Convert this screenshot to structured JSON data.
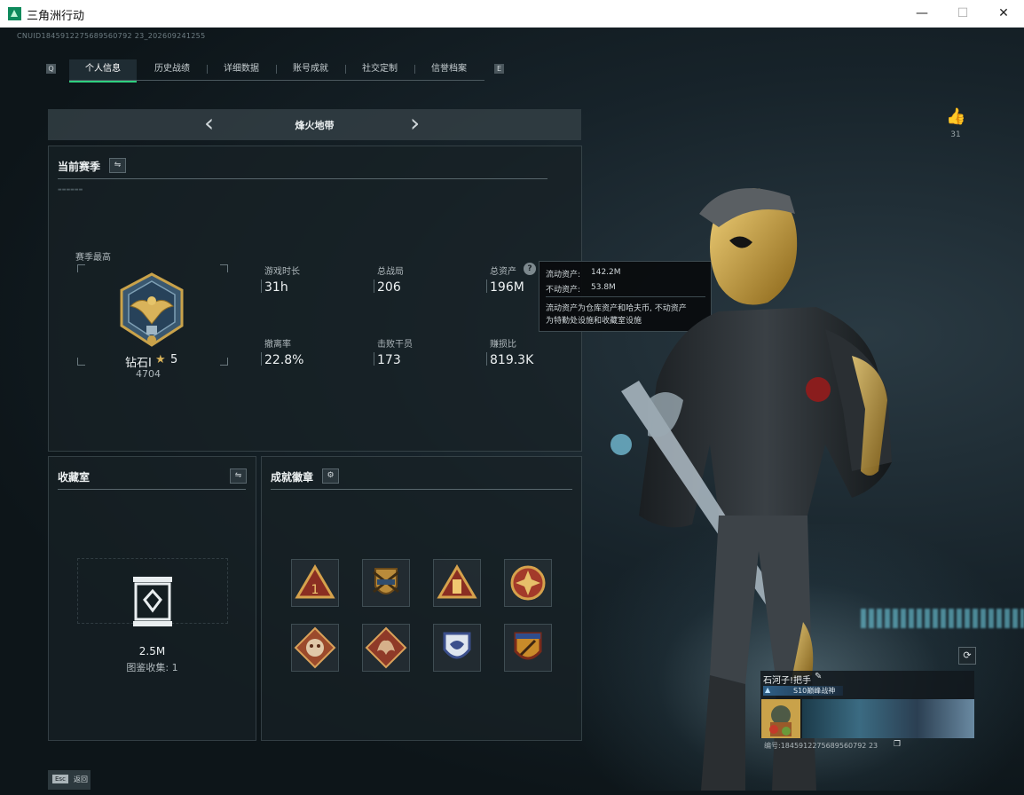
{
  "window": {
    "title": "三角洲行动",
    "minimize": "—",
    "maximize": "☐",
    "close": "✕"
  },
  "uid_line": "CNUID1845912275689560792 23_202609241255",
  "tabs": [
    "个人信息",
    "历史战绩",
    "详细数据",
    "账号成就",
    "社交定制",
    "信誉档案"
  ],
  "tab_edge_left": "Q",
  "tab_edge_right": "E",
  "mode": {
    "name": "烽火地带"
  },
  "season": {
    "title": "当前赛季",
    "peak_label": "赛季最高",
    "rank_name": "钻石Ⅰ",
    "rank_stars": "5",
    "rank_points": "4704",
    "stats": [
      {
        "label": "游戏时长",
        "value": "31h"
      },
      {
        "label": "总战局",
        "value": "206"
      },
      {
        "label": "总资产",
        "value": "196M"
      },
      {
        "label": "撤离率",
        "value": "22.8%"
      },
      {
        "label": "击败干员",
        "value": "173"
      },
      {
        "label": "赚损比",
        "value": "819.3K"
      }
    ]
  },
  "tooltip": {
    "liquid_label": "流动资产:",
    "liquid_value": "142.2M",
    "fixed_label": "不动资产:",
    "fixed_value": "53.8M",
    "note_line1": "流动资产为仓库资产和哈夫币, 不动资产",
    "note_line2": "为特勤处设施和收藏室设施"
  },
  "collection": {
    "title": "收藏室",
    "value": "2.5M",
    "caption": "图鉴收集: 1"
  },
  "achievements": {
    "title": "成就徽章",
    "badges": [
      "badge-1st-triangle",
      "badge-crossed-rifles",
      "badge-tower-triangle",
      "badge-red-cross-emblem",
      "badge-beast-diamond",
      "badge-dragon-diamond",
      "badge-shield-wings",
      "badge-gold-rifle"
    ]
  },
  "likes": {
    "count": "31"
  },
  "profile_card": {
    "name": "石河子!把手",
    "tag": "S10巅峰战神",
    "id_line": "编号:1845912275689560792 23"
  },
  "esc": {
    "key": "Esc",
    "label": "返回"
  },
  "colors": {
    "accent": "#2fd07f",
    "gold": "#c9a24a"
  }
}
